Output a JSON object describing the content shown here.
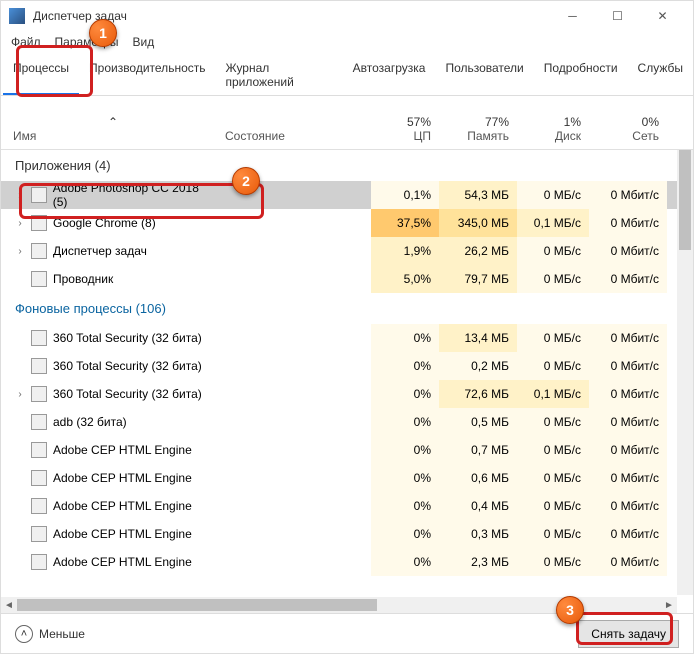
{
  "window": {
    "title": "Диспетчер задач"
  },
  "menu": {
    "file": "Файл",
    "options": "Параметры",
    "view": "Вид"
  },
  "tabs": {
    "processes": "Процессы",
    "performance": "Производительность",
    "apphistory": "Журнал приложений",
    "startup": "Автозагрузка",
    "users": "Пользователи",
    "details": "Подробности",
    "services": "Службы"
  },
  "columns": {
    "name": "Имя",
    "state": "Состояние",
    "cpu_pct": "57%",
    "cpu": "ЦП",
    "mem_pct": "77%",
    "mem": "Память",
    "disk_pct": "1%",
    "disk": "Диск",
    "net_pct": "0%",
    "net": "Сеть"
  },
  "groups": {
    "apps": "Приложения (4)",
    "bg": "Фоновые процессы (106)"
  },
  "rows": {
    "apps": [
      {
        "name": "Adobe Photoshop CC 2018 (5)",
        "cpu": "0,1%",
        "mem": "54,3 МБ",
        "disk": "0 МБ/с",
        "net": "0 Мбит/с",
        "c1": "yellow0",
        "c2": "yellow1",
        "c3": "yellow0",
        "c4": "yellow0",
        "selected": true,
        "exp": true
      },
      {
        "name": "Google Chrome (8)",
        "cpu": "37,5%",
        "mem": "345,0 МБ",
        "disk": "0,1 МБ/с",
        "net": "0 Мбит/с",
        "c1": "yellow3",
        "c2": "yellow2",
        "c3": "yellow1",
        "c4": "yellow0",
        "exp": true
      },
      {
        "name": "Диспетчер задач",
        "cpu": "1,9%",
        "mem": "26,2 МБ",
        "disk": "0 МБ/с",
        "net": "0 Мбит/с",
        "c1": "yellow1",
        "c2": "yellow1",
        "c3": "yellow0",
        "c4": "yellow0",
        "exp": true
      },
      {
        "name": "Проводник",
        "cpu": "5,0%",
        "mem": "79,7 МБ",
        "disk": "0 МБ/с",
        "net": "0 Мбит/с",
        "c1": "yellow1",
        "c2": "yellow1",
        "c3": "yellow0",
        "c4": "yellow0"
      }
    ],
    "bg": [
      {
        "name": "360 Total Security (32 бита)",
        "cpu": "0%",
        "mem": "13,4 МБ",
        "disk": "0 МБ/с",
        "net": "0 Мбит/с",
        "c1": "yellow0",
        "c2": "yellow1",
        "c3": "yellow0",
        "c4": "yellow0"
      },
      {
        "name": "360 Total Security (32 бита)",
        "cpu": "0%",
        "mem": "0,2 МБ",
        "disk": "0 МБ/с",
        "net": "0 Мбит/с",
        "c1": "yellow0",
        "c2": "yellow0",
        "c3": "yellow0",
        "c4": "yellow0"
      },
      {
        "name": "360 Total Security (32 бита)",
        "cpu": "0%",
        "mem": "72,6 МБ",
        "disk": "0,1 МБ/с",
        "net": "0 Мбит/с",
        "c1": "yellow0",
        "c2": "yellow1",
        "c3": "yellow1",
        "c4": "yellow0",
        "exp": true
      },
      {
        "name": "adb (32 бита)",
        "cpu": "0%",
        "mem": "0,5 МБ",
        "disk": "0 МБ/с",
        "net": "0 Мбит/с",
        "c1": "yellow0",
        "c2": "yellow0",
        "c3": "yellow0",
        "c4": "yellow0"
      },
      {
        "name": "Adobe CEP HTML Engine",
        "cpu": "0%",
        "mem": "0,7 МБ",
        "disk": "0 МБ/с",
        "net": "0 Мбит/с",
        "c1": "yellow0",
        "c2": "yellow0",
        "c3": "yellow0",
        "c4": "yellow0"
      },
      {
        "name": "Adobe CEP HTML Engine",
        "cpu": "0%",
        "mem": "0,6 МБ",
        "disk": "0 МБ/с",
        "net": "0 Мбит/с",
        "c1": "yellow0",
        "c2": "yellow0",
        "c3": "yellow0",
        "c4": "yellow0"
      },
      {
        "name": "Adobe CEP HTML Engine",
        "cpu": "0%",
        "mem": "0,4 МБ",
        "disk": "0 МБ/с",
        "net": "0 Мбит/с",
        "c1": "yellow0",
        "c2": "yellow0",
        "c3": "yellow0",
        "c4": "yellow0"
      },
      {
        "name": "Adobe CEP HTML Engine",
        "cpu": "0%",
        "mem": "0,3 МБ",
        "disk": "0 МБ/с",
        "net": "0 Мбит/с",
        "c1": "yellow0",
        "c2": "yellow0",
        "c3": "yellow0",
        "c4": "yellow0"
      },
      {
        "name": "Adobe CEP HTML Engine",
        "cpu": "0%",
        "mem": "2,3 МБ",
        "disk": "0 МБ/с",
        "net": "0 Мбит/с",
        "c1": "yellow0",
        "c2": "yellow0",
        "c3": "yellow0",
        "c4": "yellow0"
      }
    ]
  },
  "footer": {
    "less": "Меньше",
    "endtask": "Снять задачу"
  },
  "callouts": {
    "c1": "1",
    "c2": "2",
    "c3": "3"
  }
}
